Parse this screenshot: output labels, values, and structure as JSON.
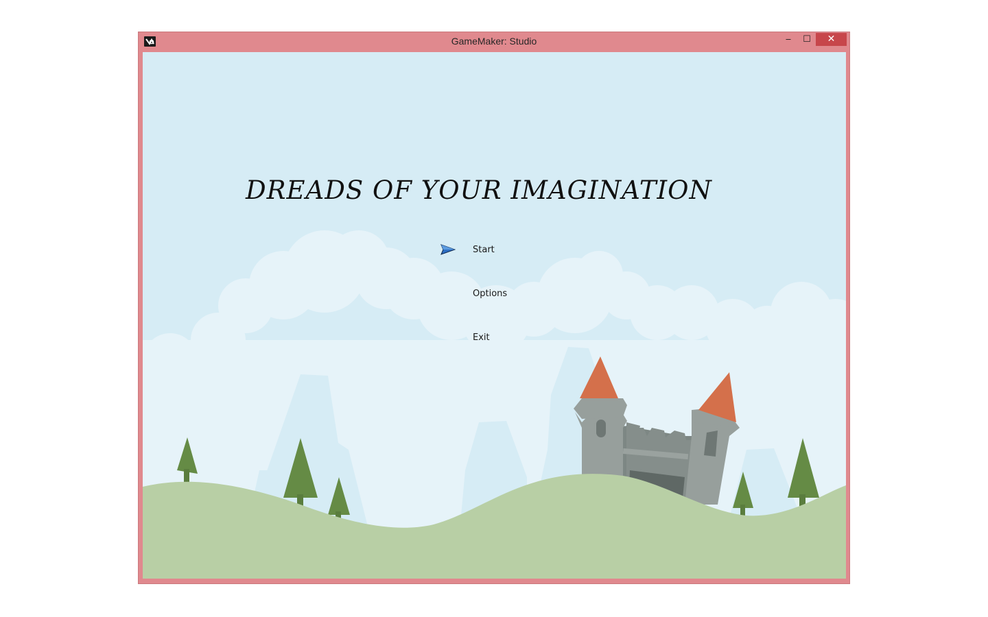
{
  "window": {
    "title": "GameMaker: Studio",
    "icon": "gamemaker-icon",
    "controls": {
      "minimize": "‒",
      "maximize": "☐",
      "close": "✕"
    }
  },
  "game": {
    "title": "DREADS OF YOUR IMAGINATION",
    "menu": {
      "items": [
        {
          "label": "Start",
          "selected": true
        },
        {
          "label": "Options",
          "selected": false
        },
        {
          "label": "Exit",
          "selected": false
        }
      ],
      "cursor_icon": "arrow-pointer-icon"
    }
  },
  "colors": {
    "window_frame": "#e0898e",
    "close_button": "#c7464b",
    "sky": "#d6ecf5",
    "clouds": "#e6f3f9",
    "hills": "#b8cfa5",
    "trees": "#658b45",
    "castle_stone": "#959d9a",
    "castle_roof": "#d4704b",
    "cursor": "#2d6fc4"
  }
}
